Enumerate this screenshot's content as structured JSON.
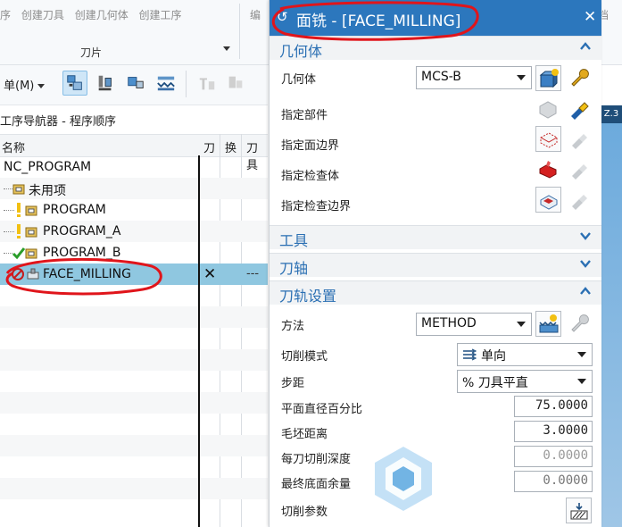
{
  "ribbon": {
    "commands": [
      "序",
      "创建刀具",
      "创建几何体",
      "创建工序"
    ],
    "group_label": "刀片",
    "extra": "编",
    "right_text": "文档"
  },
  "toolbar": {
    "menu_label": "单(M)"
  },
  "navigator": {
    "title": "工序导航器 - 程序顺序",
    "columns": [
      "名称",
      "刀",
      "换",
      "刀具"
    ],
    "rows": [
      {
        "label": "NC_PROGRAM"
      },
      {
        "label": "未用项"
      },
      {
        "label": "PROGRAM"
      },
      {
        "label": "PROGRAM_A"
      },
      {
        "label": "PROGRAM_B"
      },
      {
        "label": "FACE_MILLING",
        "col_tool": "✕",
        "col_toolname": "---"
      }
    ]
  },
  "rightstrip": {
    "label": "Z.3"
  },
  "dialog": {
    "title": "面铣 - [FACE_MILLING]",
    "close": "✕",
    "geometry": {
      "section": "几何体",
      "geom_label": "几何体",
      "geom_value": "MCS-B",
      "part_label": "指定部件",
      "face_label": "指定面边界",
      "check_label": "指定检查体",
      "check_boundary_label": "指定检查边界"
    },
    "tool_section": "工具",
    "axis_section": "刀轴",
    "path": {
      "section": "刀轨设置",
      "method_label": "方法",
      "method_value": "METHOD",
      "cut_mode_label": "切削模式",
      "cut_mode_value": "单向",
      "stepover_label": "步距",
      "stepover_value": "% 刀具平直",
      "percent_label": "平面直径百分比",
      "percent_value": "75.0000",
      "blank_label": "毛坯距离",
      "blank_value": "3.0000",
      "depth_label": "每刀切削深度",
      "depth_value": "0.0000",
      "floor_label": "最终底面余量",
      "floor_value": "0.0000",
      "params_label": "切削参数"
    }
  },
  "colors": {
    "title_bar": "#2c77bd",
    "section_text": "#2a6fb3",
    "selected_row": "#8fc7e0",
    "annotation": "#e0151b"
  }
}
